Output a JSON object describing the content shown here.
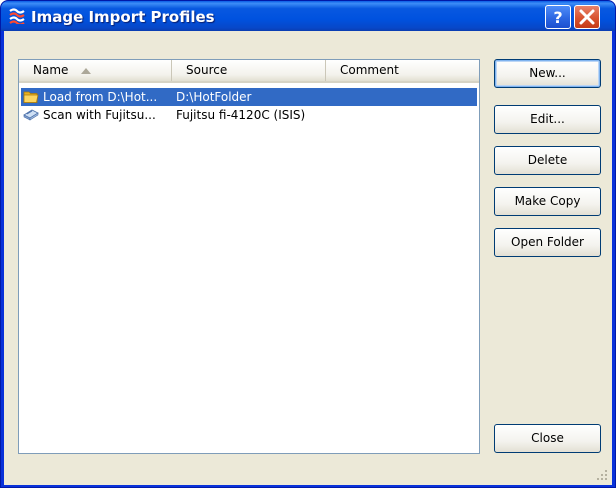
{
  "window": {
    "title": "Image Import Profiles",
    "help_glyph": "?",
    "close_glyph": "close-x"
  },
  "list": {
    "columns": [
      {
        "label": "Name",
        "sort": "ascending"
      },
      {
        "label": "Source"
      },
      {
        "label": "Comment"
      }
    ],
    "rows": [
      {
        "icon": "folder-icon",
        "name": "Load from D:\\Hot...",
        "source": "D:\\HotFolder",
        "comment": "",
        "selected": true
      },
      {
        "icon": "scanner-icon",
        "name": "Scan with Fujitsu...",
        "source": "Fujitsu fi-4120C  (ISIS)",
        "comment": "",
        "selected": false
      }
    ]
  },
  "buttons": {
    "new": "New...",
    "edit": "Edit...",
    "delete": "Delete",
    "make_copy": "Make Copy",
    "open_folder": "Open Folder",
    "close": "Close"
  },
  "colors": {
    "titlebar": "#0052df",
    "selection": "#316ac5",
    "client": "#ece9d8"
  }
}
